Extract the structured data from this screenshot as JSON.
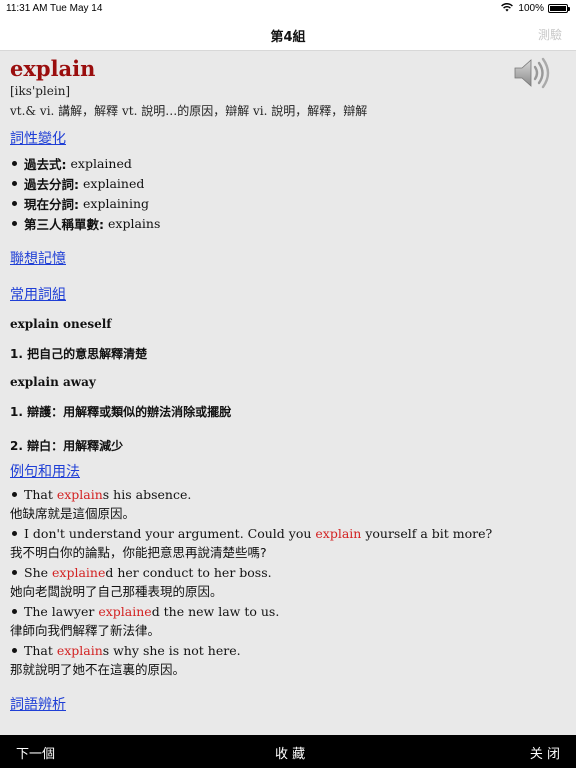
{
  "status": {
    "time": "11:31 AM",
    "date": "Tue May 14",
    "battery_text": "100%",
    "battery_level": 1.0
  },
  "nav": {
    "title": "第4組",
    "quiz": "測驗"
  },
  "entry": {
    "word": "explain",
    "phonetic": "[iks'plein]",
    "definition": "vt.& vi. 講解，解釋 vt. 說明…的原因，辯解 vi. 說明，解釋，辯解"
  },
  "sections": {
    "inflections": "詞性變化",
    "mnemonic": "聯想記憶",
    "phrases": "常用詞組",
    "examples": "例句和用法",
    "discrimination": "詞語辨析"
  },
  "forms": [
    {
      "label": "過去式:",
      "value": "explained"
    },
    {
      "label": "過去分詞:",
      "value": "explained"
    },
    {
      "label": "現在分詞:",
      "value": "explaining"
    },
    {
      "label": "第三人稱單數:",
      "value": "explains"
    }
  ],
  "phrases": [
    {
      "en": "explain oneself",
      "cn": "1. 把自己的意思解釋清楚"
    },
    {
      "en": "explain away",
      "cn": "1. 辯護：用解釋或類似的辦法消除或擺脫"
    },
    {
      "cn": "2. 辯白：用解釋減少"
    }
  ],
  "examples": [
    {
      "pre": "That ",
      "hl": "explain",
      "post": "s his absence.",
      "cn": "他缺席就是這個原因。"
    },
    {
      "pre": "I don't understand your argument. Could you ",
      "hl": "explain",
      "post": " yourself a bit more?",
      "cn": "我不明白你的論點，你能把意思再說清楚些嗎?"
    },
    {
      "pre": "She ",
      "hl": "explaine",
      "post": "d her conduct to her boss.",
      "cn": "她向老闆說明了自己那種表現的原因。"
    },
    {
      "pre": "The lawyer ",
      "hl": "explaine",
      "post": "d the new law to us.",
      "cn": "律師向我們解釋了新法律。"
    },
    {
      "pre": "That ",
      "hl": "explain",
      "post": "s why she is not here.",
      "cn": "那就說明了她不在這裏的原因。"
    }
  ],
  "bottom": {
    "next": "下一個",
    "bookmark": "收 藏",
    "close": "关 闭"
  }
}
